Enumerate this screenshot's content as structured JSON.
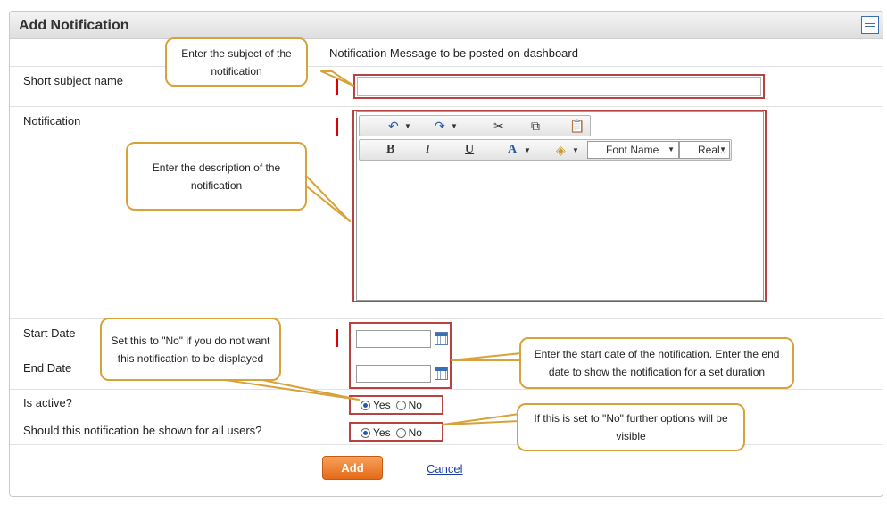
{
  "panel": {
    "title": "Add Notification",
    "header_icon": "document-list-icon"
  },
  "form": {
    "info_text": "Notification Message to be posted on dashboard",
    "short_subject_label": "Short subject name",
    "notification_label": "Notification",
    "start_date_label": "Start Date",
    "end_date_label": "End Date",
    "is_active_label": "Is active?",
    "all_users_label": "Should this notification be shown for all users?",
    "short_subject_value": "",
    "start_date_value": "",
    "end_date_value": "",
    "yes_label": "Yes",
    "no_label": "No",
    "is_active_selected": "Yes",
    "all_users_selected": "Yes"
  },
  "editor": {
    "bold": "B",
    "italic": "I",
    "underline": "U",
    "font_color": "A",
    "font_name": "Font Name",
    "font_size": "Real..",
    "icons": [
      "undo-icon",
      "redo-icon",
      "cut-icon",
      "copy-icon",
      "paste-icon",
      "fill-color-icon"
    ]
  },
  "actions": {
    "add_label": "Add",
    "cancel_label": "Cancel"
  },
  "callouts": {
    "subject": "Enter the subject of the notification",
    "description": "Enter the description of the notification",
    "active": "Set this to \"No\"  if you do not want this notification to be displayed",
    "dates": "Enter the start date of the notification.  Enter the end date to show the notification for a set duration",
    "users": "If this is set to \"No\" further options will be visible"
  },
  "colors": {
    "accent": "#e56a17",
    "callout_border": "#d8a23a",
    "highlight_box": "#b84343",
    "required": "#e00000",
    "link": "#1a3f9e"
  }
}
